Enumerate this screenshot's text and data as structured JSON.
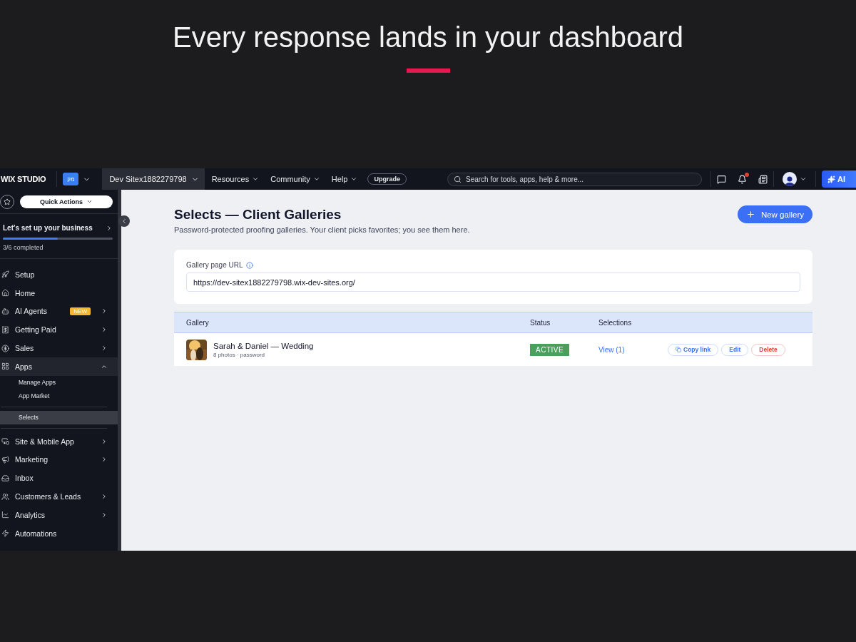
{
  "headline": "Every response lands in your dashboard",
  "topbar": {
    "brand": "WIX STUDIO",
    "site_logo": "מק",
    "site_name": "Dev Sitex1882279798",
    "menus": [
      "Resources",
      "Community",
      "Help"
    ],
    "upgrade": "Upgrade",
    "search": {
      "placeholder": "Search for tools, apps, help & more..."
    },
    "notifications": true,
    "ai": "AI"
  },
  "sidebar": {
    "quick_actions": "Quick Actions",
    "setup": {
      "title": "Let's set up your business",
      "level": 0.5,
      "progress": "3/6 completed"
    },
    "items": [
      {
        "label": "Setup",
        "expandable": false,
        "expanded": false
      },
      {
        "label": "Home",
        "expandable": false,
        "expanded": false
      },
      {
        "label": "AI Agents",
        "badge": "NEW",
        "expandable": true,
        "expanded": false
      },
      {
        "label": "Getting Paid",
        "expandable": true,
        "expanded": false
      },
      {
        "label": "Sales",
        "expandable": true,
        "expanded": false
      },
      {
        "label": "Apps",
        "expandable": true,
        "expanded": true,
        "children": [
          {
            "label": "Manage Apps",
            "selected": false,
            "divider_before": false
          },
          {
            "label": "App Market",
            "selected": false,
            "divider_before": false
          },
          {
            "label": "Selects",
            "selected": true,
            "divider_before": true
          }
        ]
      },
      {
        "label": "Site & Mobile App",
        "expandable": true,
        "expanded": false
      },
      {
        "label": "Marketing",
        "expandable": true,
        "expanded": false
      },
      {
        "label": "Inbox",
        "expandable": false,
        "expanded": false
      },
      {
        "label": "Customers & Leads",
        "expandable": true,
        "expanded": false
      },
      {
        "label": "Analytics",
        "expandable": true,
        "expanded": false
      },
      {
        "label": "Automations",
        "expandable": false,
        "expanded": false
      }
    ]
  },
  "page": {
    "title": "Selects — Client Galleries",
    "subtitle": "Password-protected proofing galleries. Your client picks favorites; you see them here.",
    "new_button": "New gallery",
    "url_card": {
      "label": "Gallery page URL",
      "value": "https://dev-sitex1882279798.wix-dev-sites.org/"
    },
    "table": {
      "columns": [
        "Gallery",
        "Status",
        "Selections"
      ],
      "rows": [
        {
          "name": "Sarah & Daniel — Wedding",
          "meta": "8 photos · password",
          "status": "ACTIVE",
          "selections": "View (1)",
          "actions": [
            {
              "label": "Copy link",
              "kind": "copy"
            },
            {
              "label": "Edit",
              "kind": "normal"
            },
            {
              "label": "Delete",
              "kind": "danger"
            }
          ]
        }
      ]
    }
  }
}
